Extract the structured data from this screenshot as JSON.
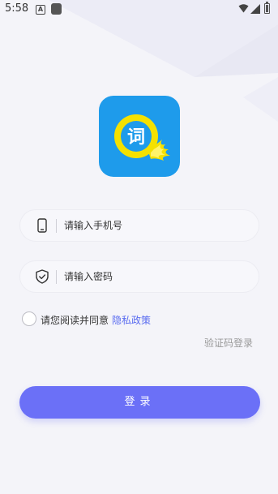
{
  "status_bar": {
    "time": "5:58",
    "a_icon_letter": "A"
  },
  "logo": {
    "glyph": "词",
    "colors": {
      "background": "#1E9BEB",
      "ring": "#F5E100",
      "inner": "#1E9BEB"
    }
  },
  "phone_field": {
    "placeholder": "请输入手机号",
    "value": "",
    "icon": "phone-icon"
  },
  "password_field": {
    "placeholder": "请输入密码",
    "value": "",
    "icon": "shield-icon"
  },
  "agreement": {
    "text": "请您阅读并同意",
    "link": "隐私政策",
    "checked": false
  },
  "sms_login_label": "验证码登录",
  "login_button_label": "登录",
  "colors": {
    "accent": "#6B70F7",
    "link": "#5A6CF0",
    "background": "#F4F4F9"
  }
}
